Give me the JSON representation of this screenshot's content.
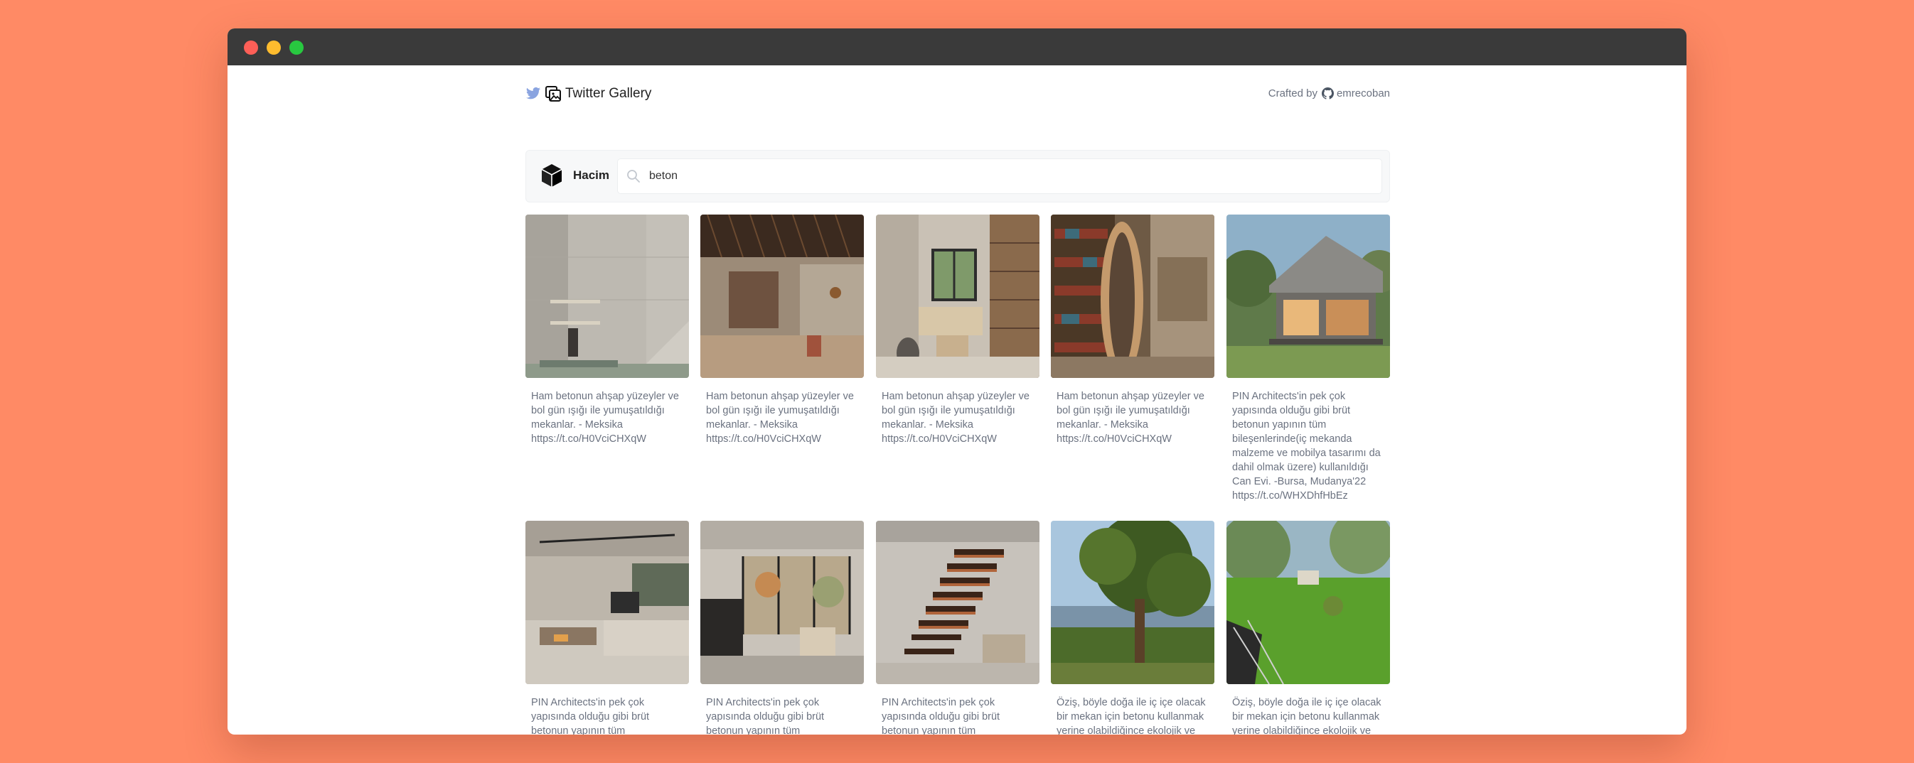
{
  "window": {
    "buttons": [
      "close",
      "minimize",
      "maximize"
    ]
  },
  "header": {
    "title": "Twitter Gallery",
    "crafted_label": "Crafted by",
    "author": "emrecoban",
    "icons": [
      "twitter-icon",
      "gallery-icon",
      "github-icon"
    ]
  },
  "account": {
    "name": "Hacim",
    "icon": "cube-icon"
  },
  "search": {
    "value": "beton",
    "icon": "search-icon"
  },
  "cards": [
    {
      "caption": "Ham betonun ahşap yüzeyler ve bol gün ışığı ile yumuşatıldığı mekanlar. - Meksika https://t.co/H0VciCHXqW"
    },
    {
      "caption": "Ham betonun ahşap yüzeyler ve bol gün ışığı ile yumuşatıldığı mekanlar. - Meksika https://t.co/H0VciCHXqW"
    },
    {
      "caption": "Ham betonun ahşap yüzeyler ve bol gün ışığı ile yumuşatıldığı mekanlar. - Meksika https://t.co/H0VciCHXqW"
    },
    {
      "caption": "Ham betonun ahşap yüzeyler ve bol gün ışığı ile yumuşatıldığı mekanlar. - Meksika https://t.co/H0VciCHXqW"
    },
    {
      "caption": "PIN Architects'in pek çok yapısında olduğu gibi brüt betonun yapının tüm bileşenlerinde(iç mekanda malzeme ve mobilya tasarımı da dahil olmak üzere) kullanıldığı Can Evi. -Bursa, Mudanya'22 https://t.co/WHXDhfHbEz"
    },
    {
      "caption": "PIN Architects'in pek çok yapısında olduğu gibi brüt betonun yapının tüm bileşenlerinde(iç mekanda malzeme ve mobilya tasarımı da"
    },
    {
      "caption": "PIN Architects'in pek çok yapısında olduğu gibi brüt betonun yapının tüm bileşenlerinde(iç mekanda malzeme ve mobilya tasarımı da"
    },
    {
      "caption": "PIN Architects'in pek çok yapısında olduğu gibi brüt betonun yapının tüm bileşenlerinde(iç mekanda malzeme ve mobilya tasarımı da"
    },
    {
      "caption": "Öziş, böyle doğa ile iç içe olacak bir mekan için betonu kullanmak yerine olabildiğince ekolojik ve sürdürülebilir bir tasarıma yöneliyor. Bundan sonraki adımı"
    },
    {
      "caption": "Öziş, böyle doğa ile iç içe olacak bir mekan için betonu kullanmak yerine olabildiğince ekolojik ve sürdürülebilir bir tasarıma yöneliyor. Bundan sonraki adımı"
    }
  ],
  "colors": {
    "background": "#FF8A65",
    "titlebar": "#3a3a3a",
    "caption_text": "#6b7280",
    "twitter_blue": "#8aa4e0"
  }
}
